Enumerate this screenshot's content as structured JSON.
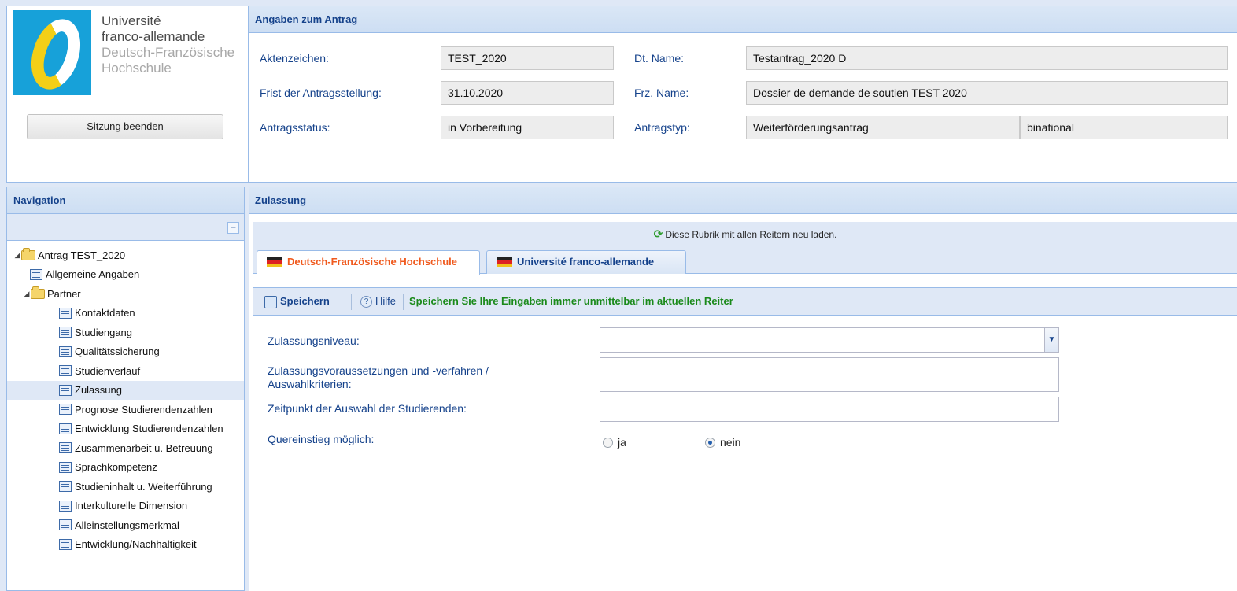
{
  "logo": {
    "line1": "Université",
    "line2": "franco-allemande",
    "line3": "Deutsch-Französische",
    "line4": "Hochschule",
    "end_session_label": "Sitzung beenden"
  },
  "application": {
    "header": "Angaben zum Antrag",
    "fields": {
      "aktenzeichen_label": "Aktenzeichen:",
      "aktenzeichen_value": "TEST_2020",
      "frist_label": "Frist der Antragsstellung:",
      "frist_value": "31.10.2020",
      "status_label": "Antragsstatus:",
      "status_value": "in Vorbereitung",
      "dt_name_label": "Dt. Name:",
      "dt_name_value": "Testantrag_2020 D",
      "frz_name_label": "Frz. Name:",
      "frz_name_value": "Dossier de demande de soutien TEST 2020",
      "typ_label": "Antragstyp:",
      "typ_value": "Weiterförderungsantrag",
      "typ_value2": "binational"
    }
  },
  "navigation": {
    "header": "Navigation",
    "collapse_label": "−",
    "root": "Antrag TEST_2020",
    "general": "Allgemeine Angaben",
    "partner": "Partner",
    "items": [
      "Kontaktdaten",
      "Studiengang",
      "Qualitätssicherung",
      "Studienverlauf",
      "Zulassung",
      "Prognose Studierendenzahlen",
      "Entwicklung Studierendenzahlen",
      "Zusammenarbeit u. Betreuung",
      "Sprachkompetenz",
      "Studieninhalt u. Weiterführung",
      "Interkulturelle Dimension",
      "Alleinstellungsmerkmal",
      "Entwicklung/Nachhaltigkeit"
    ],
    "selected": "Zulassung"
  },
  "main": {
    "header": "Zulassung",
    "reload_text": "Diese Rubrik mit allen Reitern neu laden.",
    "tabs": [
      {
        "label": "Deutsch-Französische Hochschule",
        "active": true
      },
      {
        "label": "Université franco-allemande",
        "active": false
      }
    ],
    "toolbar": {
      "save_label": "Speichern",
      "help_label": "Hilfe",
      "hint": "Speichern Sie Ihre Eingaben immer unmittelbar im aktuellen Reiter"
    },
    "form": {
      "niveau_label": "Zulassungsniveau:",
      "niveau_value": "",
      "voraussetzungen_label_line1": "Zulassungsvoraussetzungen und -verfahren /",
      "voraussetzungen_label_line2": "Auswahlkriterien:",
      "zeitpunkt_label": "Zeitpunkt der Auswahl der Studierenden:",
      "quereinstieg_label": "Quereinstieg möglich:",
      "radio_yes": "ja",
      "radio_no": "nein",
      "quereinstieg_value": "nein"
    }
  },
  "colors": {
    "accent": "#15428b",
    "panel_bg": "#dfe8f6",
    "active_tab": "#f05a1e",
    "hint": "#1a8a1a"
  }
}
